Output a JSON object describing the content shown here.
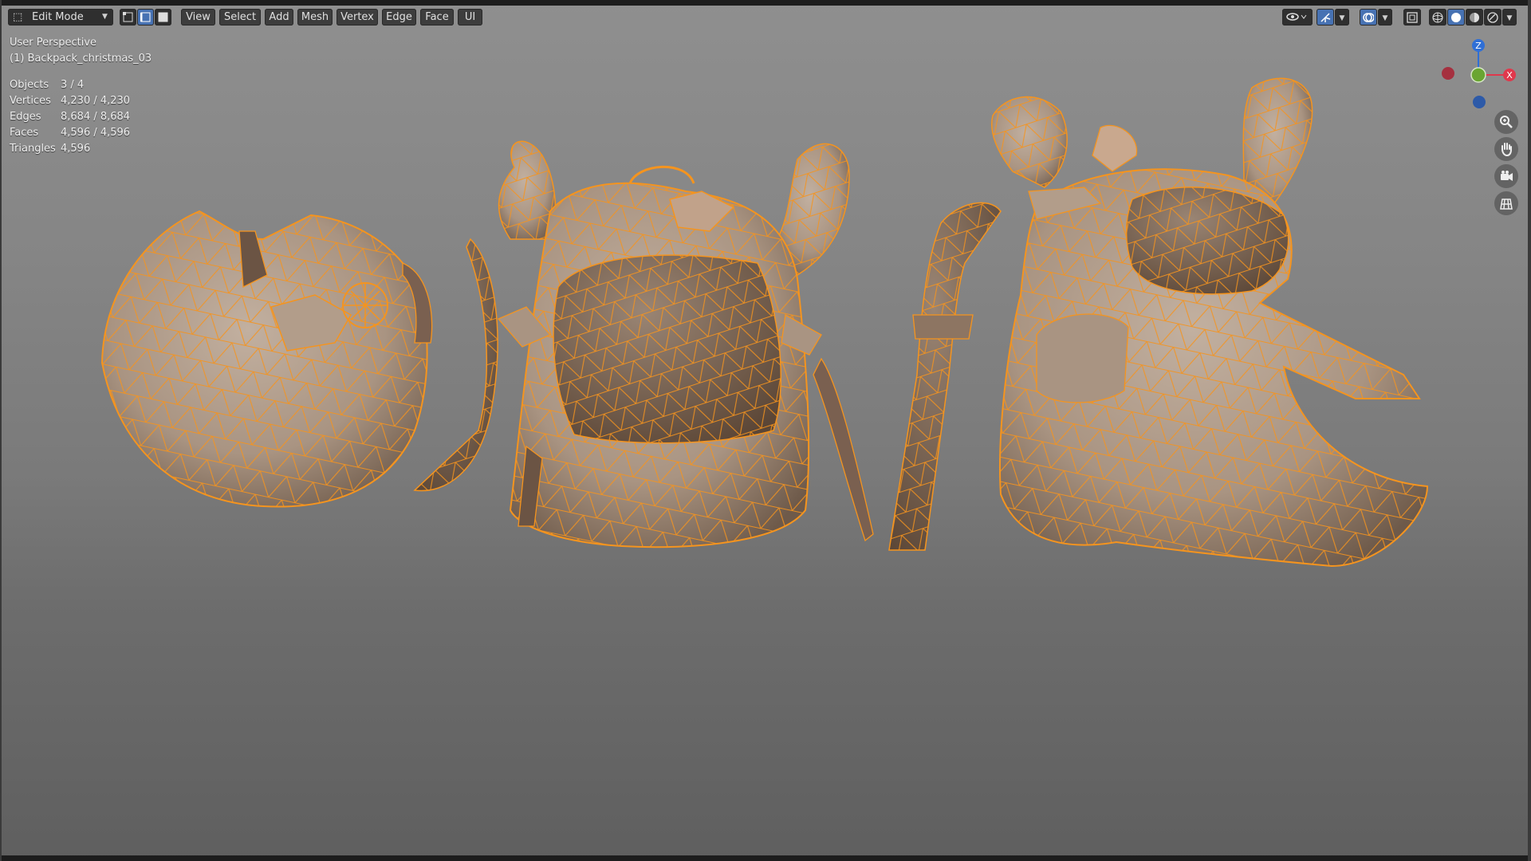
{
  "header": {
    "mode_label": "Edit Mode",
    "menus": [
      "View",
      "Select",
      "Add",
      "Mesh",
      "Vertex",
      "Edge",
      "Face",
      "UI"
    ],
    "select_modes": [
      "vertex-select-icon",
      "edge-select-icon",
      "face-select-icon"
    ],
    "right_icons": [
      "visibility-icon",
      "gizmo-icon",
      "overlay-icon",
      "xray-icon",
      "wireframe-shading-icon",
      "solid-shading-icon",
      "material-shading-icon",
      "rendered-shading-icon"
    ]
  },
  "overlay": {
    "view_name": "User Perspective",
    "object_name": "(1) Backpack_christmas_03",
    "stats": [
      {
        "label": "Objects",
        "value": "3 / 4"
      },
      {
        "label": "Vertices",
        "value": "4,230 / 4,230"
      },
      {
        "label": "Edges",
        "value": "8,684 / 8,684"
      },
      {
        "label": "Faces",
        "value": "4,596 / 4,596"
      },
      {
        "label": "Triangles",
        "value": "4,596"
      }
    ]
  },
  "gizmo": {
    "axes": [
      {
        "label": "Z",
        "color": "#2f6fd6"
      },
      {
        "label": "X",
        "color": "#e0384c"
      },
      {
        "label": "Y",
        "color": "#6aa532"
      }
    ]
  },
  "nav_tools": [
    "zoom-icon",
    "pan-hand-icon",
    "camera-icon",
    "ortho-grid-icon"
  ],
  "colors": {
    "selection": "#f5941e",
    "active_button": "#4772b3",
    "mesh_fill": "#b59f8c"
  },
  "scene": {
    "objects": [
      "backpack-round",
      "backpack-antlers",
      "backpack-reindeer"
    ]
  }
}
